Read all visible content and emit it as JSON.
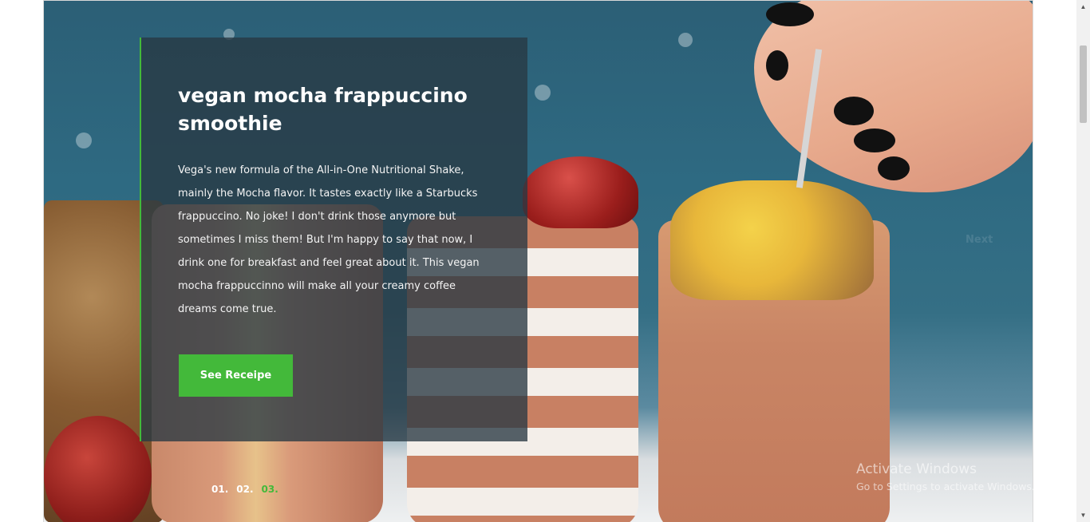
{
  "slide": {
    "title": "vegan mocha frappuccino smoothie",
    "description": "Vega's new formula of the All-in-One Nutritional Shake, mainly the Mocha flavor. It tastes exactly like a Starbucks frappuccino. No joke! I don't drink those anymore but sometimes I miss them! But I'm happy to say that now, I drink one for breakfast and feel great about it. This vegan mocha frappuccinno will make all your creamy coffee dreams come true.",
    "button_label": "See Receipe",
    "next_label": "Next"
  },
  "pagination": [
    {
      "label": "01."
    },
    {
      "label": "02."
    },
    {
      "label": "03.",
      "active": true
    }
  ],
  "watermark": {
    "title": "Activate Windows",
    "subtitle": "Go to Settings to activate Windows."
  },
  "colors": {
    "accent": "#43b93a",
    "card_bg": "rgba(40,56,66,0.78)"
  },
  "scrollbar": {
    "up_icon": "chevron-up-icon",
    "down_icon": "chevron-down-icon"
  }
}
